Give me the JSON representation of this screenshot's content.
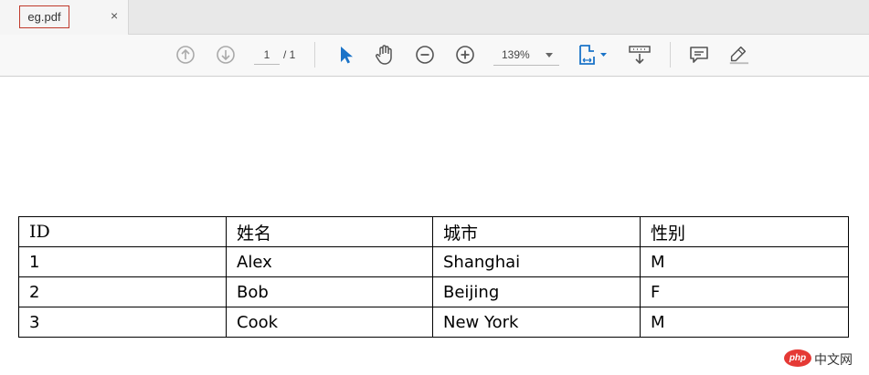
{
  "tab": {
    "title": "eg.pdf",
    "close_glyph": "×"
  },
  "toolbar": {
    "page_current": "1",
    "page_total": "/ 1",
    "zoom": "139%",
    "icons": {
      "prev_page": "arrow-up-circle-icon",
      "next_page": "arrow-down-circle-icon",
      "select": "cursor-icon",
      "pan": "hand-icon",
      "zoom_out": "minus-circle-icon",
      "zoom_in": "plus-circle-icon",
      "fit": "fit-page-icon",
      "scroll_mode": "scroll-icon",
      "comment": "comment-icon",
      "highlight": "pen-icon"
    },
    "colors": {
      "active": "#1a73c8",
      "icon": "#555555",
      "disabled": "#aaaaaa"
    }
  },
  "table": {
    "header": [
      "ID",
      "姓名",
      "城市",
      "性别"
    ],
    "rows": [
      [
        "1",
        "Alex",
        "Shanghai",
        "M"
      ],
      [
        "2",
        "Bob",
        "Beijing",
        "F"
      ],
      [
        "3",
        "Cook",
        "New York",
        "M"
      ]
    ]
  },
  "watermark": {
    "logo_text": "php",
    "site_text": "中文网"
  }
}
